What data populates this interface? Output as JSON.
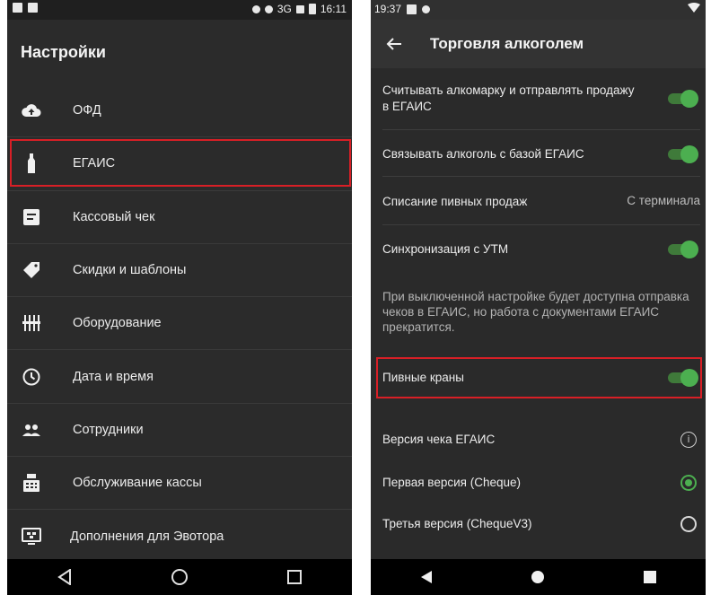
{
  "left_screen": {
    "status": {
      "network": "3G",
      "time": "16:11"
    },
    "title": "Настройки",
    "items": [
      {
        "label": "ОФД",
        "icon": "cloud-upload-icon"
      },
      {
        "label": "ЕГАИС",
        "icon": "bottle-icon"
      },
      {
        "label": "Кассовый чек",
        "icon": "receipt-icon"
      },
      {
        "label": "Скидки и шаблоны",
        "icon": "tag-icon"
      },
      {
        "label": "Оборудование",
        "icon": "equipment-icon"
      },
      {
        "label": "Дата и время",
        "icon": "clock-icon"
      },
      {
        "label": "Сотрудники",
        "icon": "people-icon"
      },
      {
        "label": "Обслуживание кассы",
        "icon": "cash-register-icon"
      },
      {
        "label": "Дополнения для Эвотора",
        "icon": "apps-icon"
      }
    ],
    "highlighted_item": "ЕГАИС"
  },
  "right_screen": {
    "status": {
      "time": "19:37"
    },
    "title": "Торговля алкоголем",
    "settings": [
      {
        "label": "Считывать алкомарку и отправлять продажу в ЕГАИС",
        "control": "switch",
        "state": "on"
      },
      {
        "label": "Связывать алкоголь с базой ЕГАИС",
        "control": "switch",
        "state": "on"
      },
      {
        "label": "Списание пивных продаж",
        "value": "С терминала"
      },
      {
        "label": "Синхронизация с УТМ",
        "control": "switch",
        "state": "on"
      }
    ],
    "hint": "При выключенной настройке будет доступна отправка чеков в ЕГАИС, но работа с документами ЕГАИС прекратится.",
    "beer_taps": {
      "label": "Пивные краны",
      "control": "switch",
      "state": "on"
    },
    "receipt_version": {
      "label": "Версия чека ЕГАИС",
      "options": [
        {
          "label": "Первая версия (Cheque)",
          "selected": true
        },
        {
          "label": "Третья версия (ChequeV3)",
          "selected": false
        }
      ]
    }
  },
  "colors": {
    "accent": "#4caf50",
    "highlight": "#d81f26",
    "background": "#2b2b2b"
  }
}
